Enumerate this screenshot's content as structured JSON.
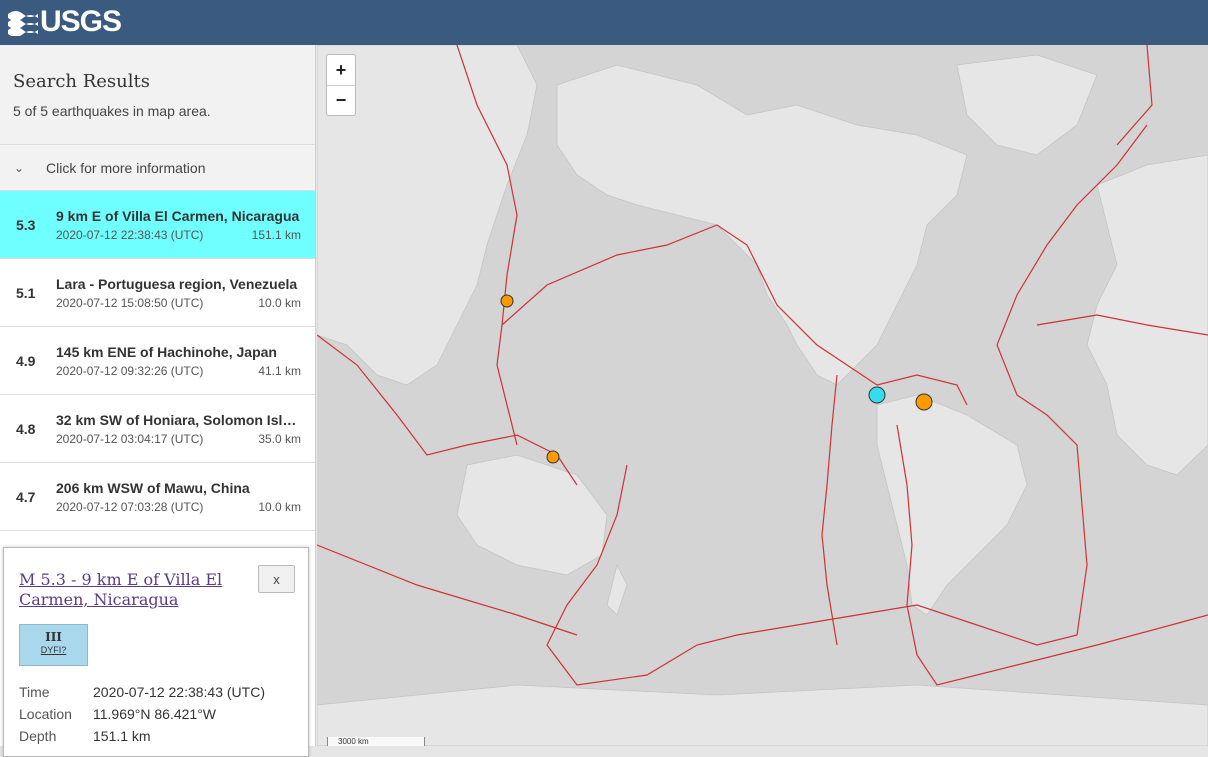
{
  "header": {
    "logo_text": "USGS",
    "logo_icon": "usgs-wave-icon",
    "color": "#3b5a80"
  },
  "sidebar": {
    "title": "Search Results",
    "subtitle": "5 of 5 earthquakes in map area.",
    "more_info_label": "Click for more information",
    "more_info_icon": "chevron-down-icon",
    "selected_color": "#70ffff",
    "earthquakes": [
      {
        "mag": "5.3",
        "place": "9 km E of Villa El Carmen, Nicaragua",
        "time": "2020-07-12 22:38:43 (UTC)",
        "depth": "151.1 km"
      },
      {
        "mag": "5.1",
        "place": "Lara - Portuguesa region, Venezuela",
        "time": "2020-07-12 15:08:50 (UTC)",
        "depth": "10.0 km"
      },
      {
        "mag": "4.9",
        "place": "145 km ENE of Hachinohe, Japan",
        "time": "2020-07-12 09:32:26 (UTC)",
        "depth": "41.1 km"
      },
      {
        "mag": "4.8",
        "place": "32 km SW of Honiara, Solomon Isla…",
        "time": "2020-07-12 03:04:17 (UTC)",
        "depth": "35.0 km"
      },
      {
        "mag": "4.7",
        "place": "206 km WSW of Mawu, China",
        "time": "2020-07-12 07:03:28 (UTC)",
        "depth": "10.0 km"
      }
    ]
  },
  "popup": {
    "title": "M 5.3 - 9 km E of Villa El Carmen, Nicaragua",
    "close_label": "x",
    "dyfi_level": "III",
    "dyfi_label": "DYFI?",
    "dyfi_color": "#a9d8ec",
    "details": [
      {
        "key": "Time",
        "value": "2020-07-12 22:38:43 (UTC)"
      },
      {
        "key": "Location",
        "value": "11.969°N 86.421°W"
      },
      {
        "key": "Depth",
        "value": "151.1 km"
      }
    ]
  },
  "map": {
    "zoom_in_label": "+",
    "zoom_out_label": "−",
    "scale_label": "3000 km",
    "marker_color": "#ff9900",
    "selected_marker_color": "#33ddee",
    "plate_boundary_color": "#cc3333"
  }
}
